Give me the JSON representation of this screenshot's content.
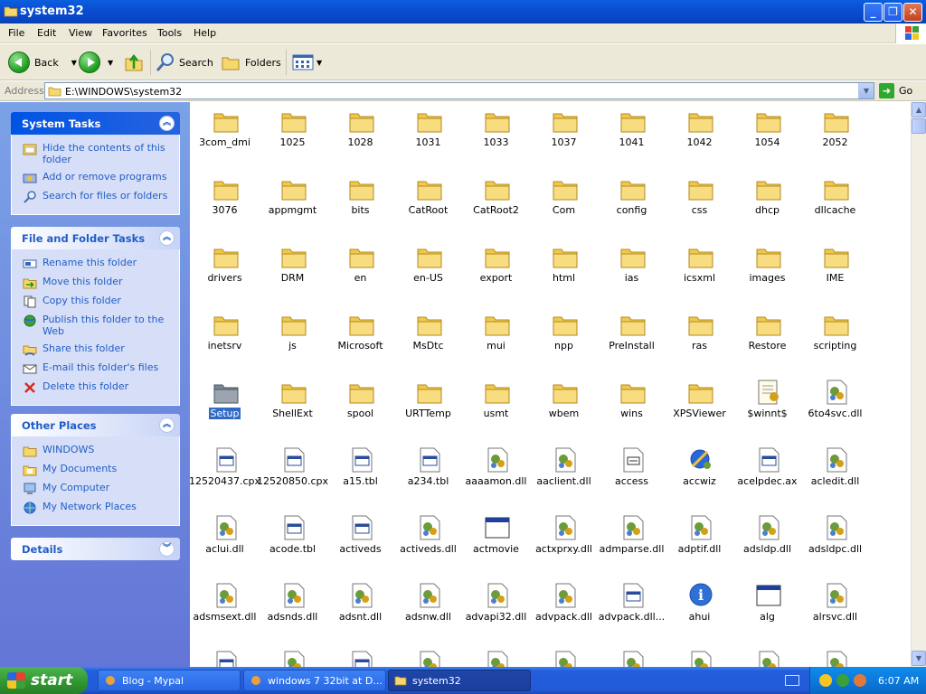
{
  "window": {
    "title": "system32"
  },
  "menu": [
    "File",
    "Edit",
    "View",
    "Favorites",
    "Tools",
    "Help"
  ],
  "toolbar": {
    "back": "Back",
    "search": "Search",
    "folders": "Folders"
  },
  "address": {
    "label": "Address",
    "path": "E:\\WINDOWS\\system32",
    "go": "Go"
  },
  "panels": {
    "system_tasks": {
      "title": "System Tasks",
      "items": [
        "Hide the contents of this folder",
        "Add or remove programs",
        "Search for files or folders"
      ]
    },
    "file_tasks": {
      "title": "File and Folder Tasks",
      "items": [
        "Rename this folder",
        "Move this folder",
        "Copy this folder",
        "Publish this folder to the Web",
        "Share this folder",
        "E-mail this folder's files",
        "Delete this folder"
      ]
    },
    "other_places": {
      "title": "Other Places",
      "items": [
        "WINDOWS",
        "My Documents",
        "My Computer",
        "My Network Places"
      ]
    },
    "details": {
      "title": "Details"
    }
  },
  "files": [
    [
      "3com_dmi",
      "folder"
    ],
    [
      "1025",
      "folder"
    ],
    [
      "1028",
      "folder"
    ],
    [
      "1031",
      "folder"
    ],
    [
      "1033",
      "folder"
    ],
    [
      "1037",
      "folder"
    ],
    [
      "1041",
      "folder"
    ],
    [
      "1042",
      "folder"
    ],
    [
      "1054",
      "folder"
    ],
    [
      "2052",
      "folder"
    ],
    [
      "3076",
      "folder"
    ],
    [
      "appmgmt",
      "folder"
    ],
    [
      "bits",
      "folder"
    ],
    [
      "CatRoot",
      "folder"
    ],
    [
      "CatRoot2",
      "folder"
    ],
    [
      "Com",
      "folder"
    ],
    [
      "config",
      "folder"
    ],
    [
      "css",
      "folder"
    ],
    [
      "dhcp",
      "folder"
    ],
    [
      "dllcache",
      "folder"
    ],
    [
      "drivers",
      "folder"
    ],
    [
      "DRM",
      "folder"
    ],
    [
      "en",
      "folder"
    ],
    [
      "en-US",
      "folder"
    ],
    [
      "export",
      "folder"
    ],
    [
      "html",
      "folder"
    ],
    [
      "ias",
      "folder"
    ],
    [
      "icsxml",
      "folder"
    ],
    [
      "images",
      "folder"
    ],
    [
      "IME",
      "folder"
    ],
    [
      "inetsrv",
      "folder"
    ],
    [
      "js",
      "folder"
    ],
    [
      "Microsoft",
      "folder"
    ],
    [
      "MsDtc",
      "folder"
    ],
    [
      "mui",
      "folder"
    ],
    [
      "npp",
      "folder"
    ],
    [
      "PreInstall",
      "folder"
    ],
    [
      "ras",
      "folder"
    ],
    [
      "Restore",
      "folder"
    ],
    [
      "scripting",
      "folder"
    ],
    [
      "Setup",
      "folder-sel"
    ],
    [
      "ShellExt",
      "folder"
    ],
    [
      "spool",
      "folder"
    ],
    [
      "URTTemp",
      "folder"
    ],
    [
      "usmt",
      "folder"
    ],
    [
      "wbem",
      "folder"
    ],
    [
      "wins",
      "folder"
    ],
    [
      "XPSViewer",
      "folder"
    ],
    [
      "$winnt$",
      "notes"
    ],
    [
      "6to4svc.dll",
      "dll"
    ],
    [
      "12520437.cpx",
      "sys"
    ],
    [
      "12520850.cpx",
      "sys"
    ],
    [
      "a15.tbl",
      "sys"
    ],
    [
      "a234.tbl",
      "sys"
    ],
    [
      "aaaamon.dll",
      "dll"
    ],
    [
      "aaclient.dll",
      "dll"
    ],
    [
      "access",
      "sys2"
    ],
    [
      "accwiz",
      "wiz"
    ],
    [
      "acelpdec.ax",
      "sys"
    ],
    [
      "acledit.dll",
      "dll"
    ],
    [
      "aclui.dll",
      "dll"
    ],
    [
      "acode.tbl",
      "sys"
    ],
    [
      "activeds",
      "sys"
    ],
    [
      "activeds.dll",
      "dll"
    ],
    [
      "actmovie",
      "app"
    ],
    [
      "actxprxy.dll",
      "dll"
    ],
    [
      "admparse.dll",
      "dll"
    ],
    [
      "adptif.dll",
      "dll"
    ],
    [
      "adsldp.dll",
      "dll"
    ],
    [
      "adsldpc.dll",
      "dll"
    ],
    [
      "adsmsext.dll",
      "dll"
    ],
    [
      "adsnds.dll",
      "dll"
    ],
    [
      "adsnt.dll",
      "dll"
    ],
    [
      "adsnw.dll",
      "dll"
    ],
    [
      "advapi32.dll",
      "dll"
    ],
    [
      "advpack.dll",
      "dll"
    ],
    [
      "advpack.dll...",
      "sys"
    ],
    [
      "ahui",
      "info"
    ],
    [
      "alg",
      "app"
    ],
    [
      "alrsvc.dll",
      "dll"
    ],
    [
      "",
      "sys"
    ],
    [
      "",
      "dll"
    ],
    [
      "",
      "sys"
    ],
    [
      "",
      "dll"
    ],
    [
      "",
      "dll"
    ],
    [
      "",
      "dll"
    ],
    [
      "",
      "dll"
    ],
    [
      "",
      "dll"
    ],
    [
      "",
      "dll"
    ],
    [
      "",
      "dll"
    ]
  ],
  "taskbar": {
    "start": "start",
    "tasks": [
      "Blog - Mypal",
      "windows 7 32bit at D...",
      "system32"
    ],
    "clock": "6:07 AM"
  },
  "colors": {
    "title_blue": "#0a4ed0",
    "pane_blue": "#6375d6",
    "link_blue": "#215dc6",
    "folder_yellow": "#f5d76e"
  }
}
